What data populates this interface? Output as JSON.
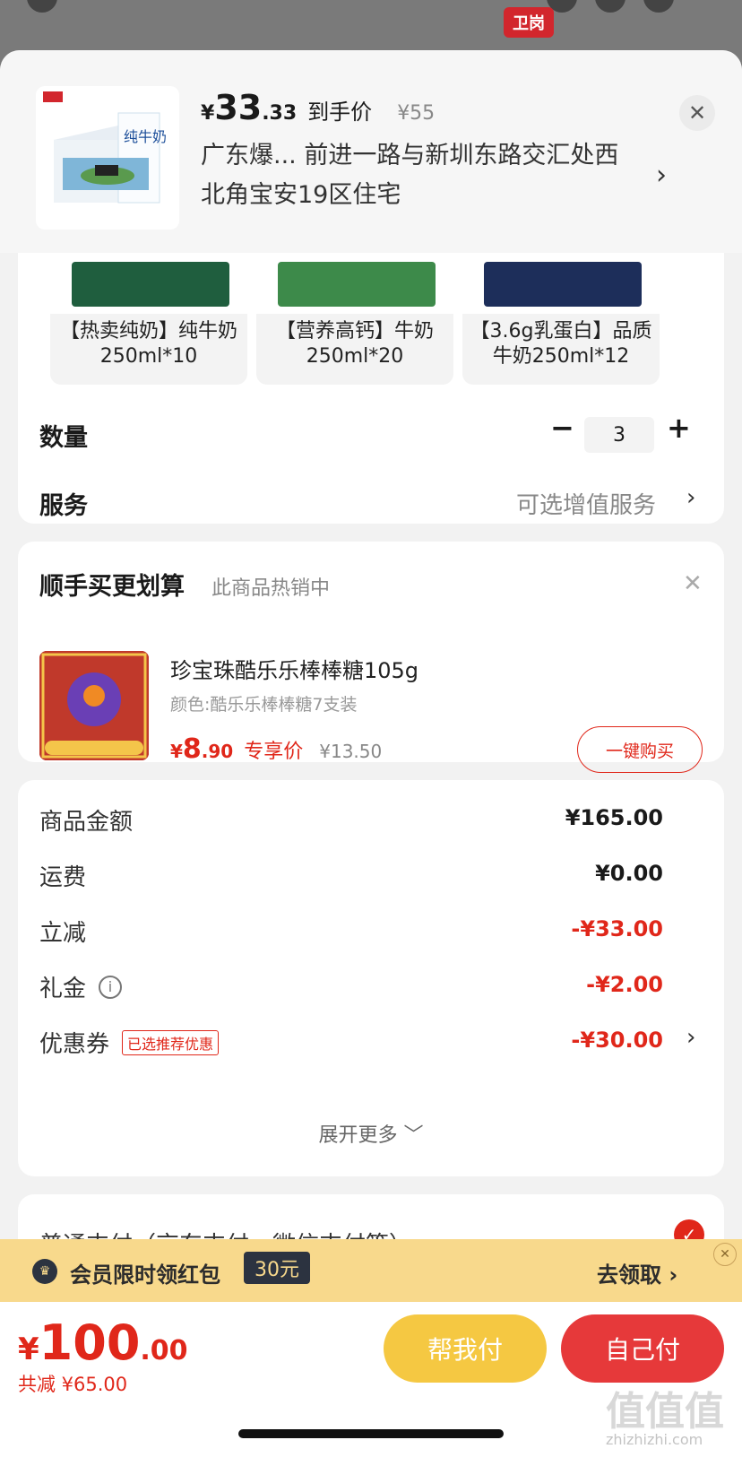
{
  "brand_logo": "卫岗",
  "product": {
    "price_symbol": "¥",
    "price_int": "33",
    "price_dec": ".33",
    "price_tag": "到手价",
    "price_old": "¥55",
    "address": "广东爆... 前进一路与新圳东路交汇处西北角宝安19区住宅",
    "thumb_text": "纯牛奶"
  },
  "variants": [
    {
      "label": "【热卖纯奶】纯牛奶250ml*10",
      "color": "#1f5e3e"
    },
    {
      "label": "【营养高钙】牛奶250ml*20",
      "color": "#3d8a4a"
    },
    {
      "label": "【3.6g乳蛋白】品质牛奶250ml*12",
      "color": "#1d2e5a"
    }
  ],
  "quantity": {
    "label": "数量",
    "value": "3",
    "minus": "−",
    "plus": "+"
  },
  "service": {
    "label": "服务",
    "value": "可选增值服务"
  },
  "bundle": {
    "title": "顺手买更划算",
    "subtitle": "此商品热销中",
    "name": "珍宝珠酷乐乐棒棒糖105g",
    "color": "颜色:酷乐乐棒棒糖7支装",
    "price_symbol": "¥",
    "price_int": "8",
    "price_dec": ".90",
    "price_tag": "专享价",
    "price_old": "¥13.50",
    "buy_label": "一键购买",
    "img_badge": "爆款商品券后9折起"
  },
  "summary": [
    {
      "label": "商品金额",
      "value": "¥165.00",
      "red": false
    },
    {
      "label": "运费",
      "value": "¥0.00",
      "red": false
    },
    {
      "label": "立减",
      "value": "-¥33.00",
      "red": true
    },
    {
      "label": "礼金",
      "value": "-¥2.00",
      "red": true
    },
    {
      "label": "优惠券",
      "value": "-¥30.00",
      "red": true,
      "badge": "已选推荐优惠"
    }
  ],
  "expand_label": "展开更多 ﹀",
  "payment": {
    "label": "普通支付（京东支付、微信支付等）"
  },
  "member": {
    "text": "会员限时领红包",
    "amount": "30元",
    "go": "去领取"
  },
  "bottom": {
    "total_symbol": "¥",
    "total_int": "100",
    "total_dec": ".00",
    "saved": "共减 ¥65.00",
    "help_label": "帮我付",
    "self_label": "自己付"
  },
  "watermark": {
    "main": "值值值",
    "sub": "zhizhizhi.com"
  }
}
